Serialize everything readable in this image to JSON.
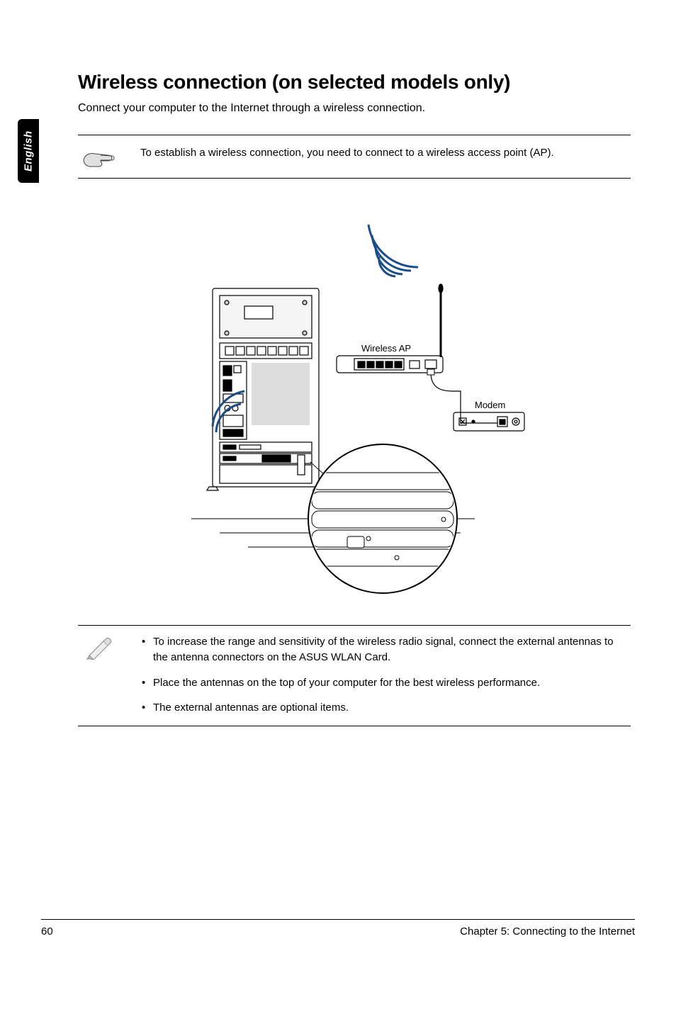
{
  "side_tab": "English",
  "heading": "Wireless connection (on selected models only)",
  "intro": "Connect your computer to the Internet through a wireless connection.",
  "note1": {
    "text": "To establish a wireless connection, you need to connect to a wireless access point (AP)."
  },
  "diagram": {
    "wireless_ap_label": "Wireless AP",
    "modem_label": "Modem"
  },
  "note2": {
    "items": [
      "To increase the range and sensitivity of the wireless radio signal, connect the external antennas to the antenna connectors on the ASUS WLAN Card.",
      "Place the antennas on the top of your computer for the best wireless performance.",
      "The external antennas are optional items."
    ]
  },
  "footer": {
    "page_number": "60",
    "chapter": "Chapter 5: Connecting to the Internet"
  }
}
